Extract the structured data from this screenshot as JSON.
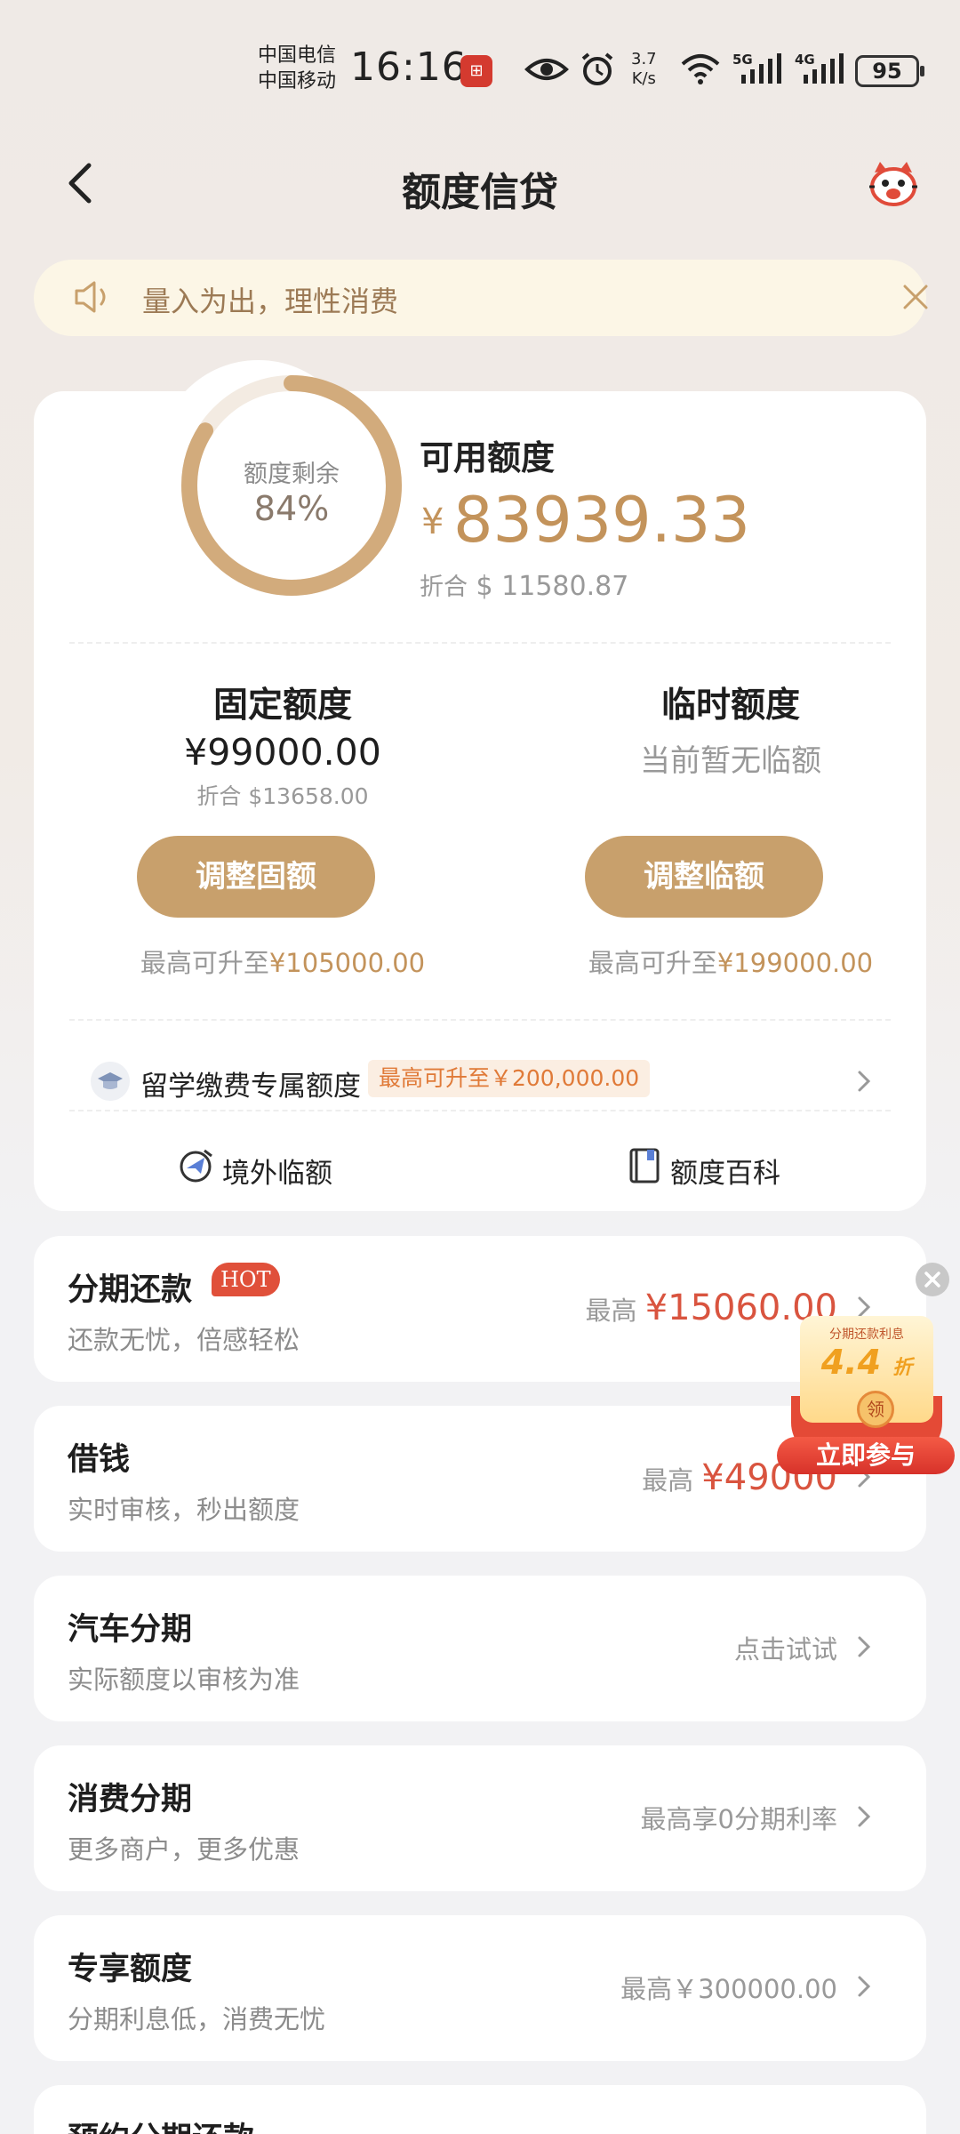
{
  "status_bar": {
    "carrier_1": "中国电信",
    "carrier_2": "中国移动",
    "time": "16:16",
    "speed_value": "3.7",
    "speed_unit": "K/s",
    "network_1": "5G",
    "network_2": "4G",
    "battery": "95"
  },
  "header": {
    "title": "额度信贷"
  },
  "notice": {
    "text": "量入为出，理性消费"
  },
  "credit": {
    "ring_label": "额度剩余",
    "ring_percent": "84%",
    "ring_fraction": 0.84,
    "available_label": "可用额度",
    "available_currency": "¥",
    "available_value": "83939.33",
    "available_conv_prefix": "折合",
    "available_conv_value": "$ 11580.87"
  },
  "fixed": {
    "title": "固定额度",
    "value": "¥99000.00",
    "conversion": "折合 $13658.00",
    "button": "调整固额",
    "max_prefix": "最高可升至",
    "max_value": "¥105000.00"
  },
  "temporary": {
    "title": "临时额度",
    "empty_text": "当前暂无临额",
    "button": "调整临额",
    "max_prefix": "最高可升至",
    "max_value": "¥199000.00"
  },
  "study_abroad": {
    "label": "留学缴费专属额度",
    "tag": "最高可升至￥200,000.00"
  },
  "quick_links": [
    {
      "label": "境外临额",
      "icon": "plane-globe-icon"
    },
    {
      "label": "额度百科",
      "icon": "book-icon"
    }
  ],
  "services": [
    {
      "title": "分期还款",
      "badge": "HOT",
      "subtitle": "还款无忧，倍感轻松",
      "right_prefix": "最高",
      "right_value": "¥15060.00"
    },
    {
      "title": "借钱",
      "subtitle": "实时审核，秒出额度",
      "right_prefix": "最高",
      "right_value": "¥49000"
    },
    {
      "title": "汽车分期",
      "subtitle": "实际额度以审核为准",
      "right_text": "点击试试"
    },
    {
      "title": "消费分期",
      "subtitle": "更多商户，更多优惠",
      "right_text": "最高享0分期利率"
    },
    {
      "title": "专享额度",
      "subtitle": "分期利息低，消费无忧",
      "right_text": "最高￥300000.00"
    },
    {
      "title": "预约分期还款"
    }
  ],
  "promo": {
    "top_text": "分期还款利息",
    "rate": "4.4",
    "rate_unit": "折",
    "coin_text": "领",
    "button": "立即参与"
  },
  "colors": {
    "accent_gold": "#c8a06c",
    "accent_text": "#c3935b",
    "red": "#d9543f",
    "orange_tag": "#e07a38",
    "notice_bg": "#fcf6e6"
  }
}
